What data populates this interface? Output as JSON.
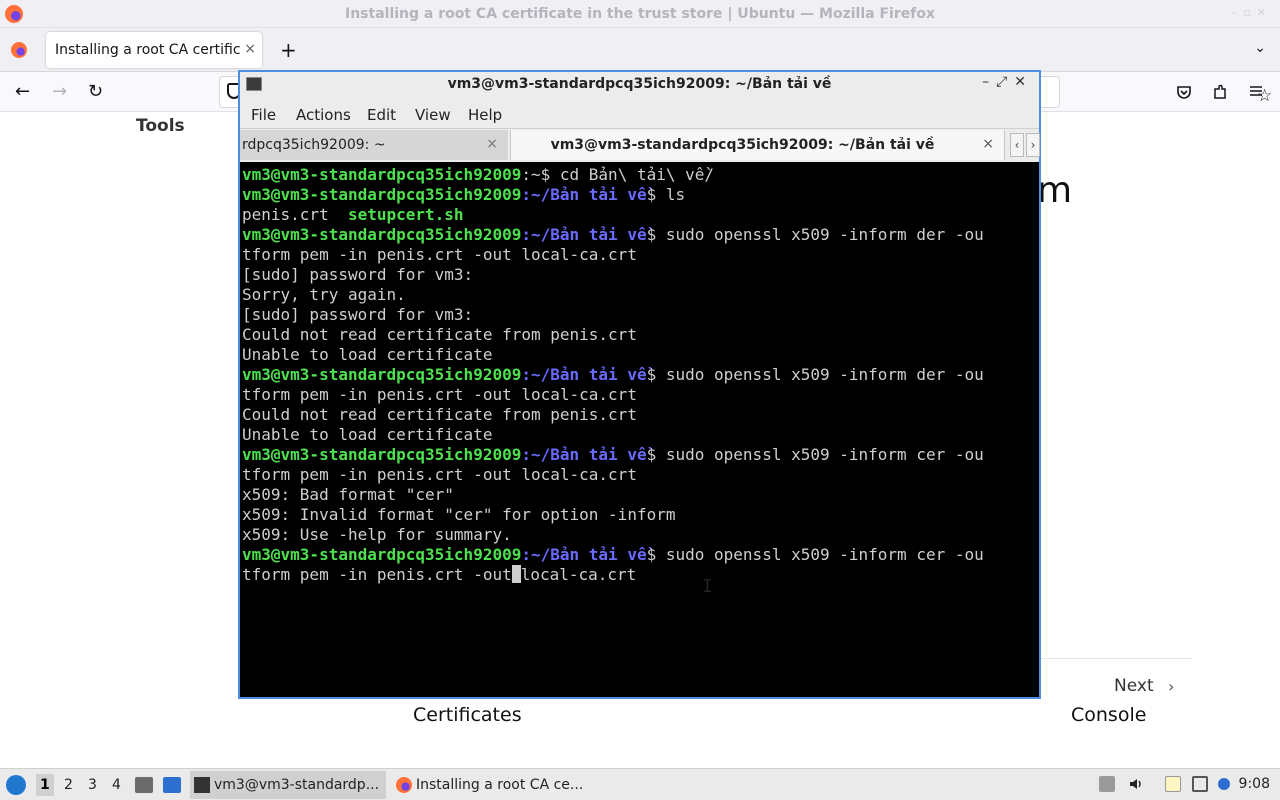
{
  "firefox": {
    "window_title": "Installing a root CA certificate in the trust store | Ubuntu — Mozilla Firefox",
    "tab_label": "Installing a root CA certificat",
    "tab_close": "×",
    "new_tab": "+",
    "tab_list": "⌄",
    "nav": {
      "back": "←",
      "forward": "→",
      "reload": "↻",
      "star": "☆"
    }
  },
  "page": {
    "sidebar_heading": "Tools",
    "heading_fragment": "m",
    "next_label": "Next",
    "next_chevron": "›",
    "prev_title": "Certificates",
    "next_title": "Console"
  },
  "terminal": {
    "window_title": "vm3@vm3-standardpcq35ich92009: ~/Bản tải về",
    "menu": [
      "File",
      "Actions",
      "Edit",
      "View",
      "Help"
    ],
    "tabs": [
      {
        "label": "rdpcq35ich92009: ~",
        "close": "×"
      },
      {
        "label": "vm3@vm3-standardpcq35ich92009: ~/Bản tải về",
        "close": "×"
      }
    ],
    "scroll_left": "‹",
    "scroll_right": "›",
    "prompt_user": "vm3@vm3-standardpcq35ich92009",
    "prompt_home": ":~$ ",
    "prompt_path": ":~/Bản tải về",
    "prompt_dollar": "$ ",
    "lines": {
      "l1_cmd": "cd Bản\\ tải\\ về/",
      "l2_cmd": "ls",
      "l3_file1": "penis.crt  ",
      "l3_file2": "setupcert.sh",
      "l4_cmd": "sudo openssl x509 -inform der -ou",
      "l5": "tform pem -in penis.crt -out local-ca.crt",
      "l6": "[sudo] password for vm3:",
      "l7": "Sorry, try again.",
      "l8": "[sudo] password for vm3:",
      "l9": "Could not read certificate from penis.crt",
      "l10": "Unable to load certificate",
      "l11_cmd": "sudo openssl x509 -inform der -ou",
      "l12": "tform pem -in penis.crt -out local-ca.crt",
      "l13": "Could not read certificate from penis.crt",
      "l14": "Unable to load certificate",
      "l15_cmd": "sudo openssl x509 -inform cer -ou",
      "l16": "tform pem -in penis.crt -out local-ca.crt",
      "l17": "x509: Bad format \"cer\"",
      "l18": "x509: Invalid format \"cer\" for option -inform",
      "l19": "x509: Use -help for summary.",
      "l20_cmd": "sudo openssl x509 -inform cer -ou",
      "l21_a": "tform pem -in penis.crt -out",
      "l21_b": "local-ca.crt"
    }
  },
  "taskbar": {
    "workspaces": [
      "1",
      "2",
      "3",
      "4"
    ],
    "tasks": [
      {
        "label": "vm3@vm3-standardp..."
      },
      {
        "label": "Installing a root CA ce..."
      }
    ],
    "clock": "9:08"
  }
}
